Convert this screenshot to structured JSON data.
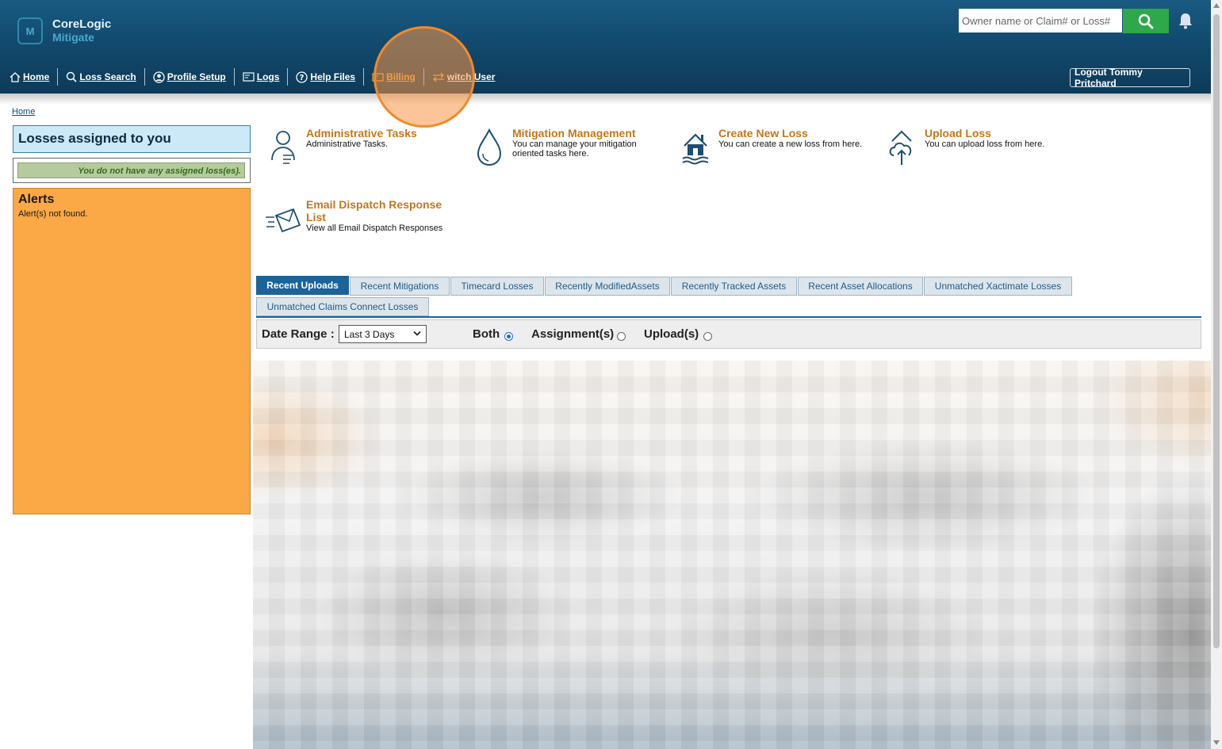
{
  "header": {
    "logo_line1": "CoreLogic",
    "logo_line2": "Mitigate",
    "logo_mark": "M",
    "search_placeholder": "Owner name or Claim# or Loss#",
    "logout_label": "Logout Tommy Pritchard"
  },
  "nav": {
    "items": [
      {
        "label": "Home",
        "icon": "home-icon"
      },
      {
        "label": "Loss Search",
        "icon": "search-icon"
      },
      {
        "label": "Profile Setup",
        "icon": "user-icon"
      },
      {
        "label": "Logs",
        "icon": "log-icon"
      },
      {
        "label": "Help Files",
        "icon": "help-icon"
      },
      {
        "label": "Billing",
        "icon": "billing-icon"
      },
      {
        "label": "witch User",
        "icon": "switch-icon"
      }
    ]
  },
  "breadcrumb": "Home",
  "sidebar": {
    "losses_title": "Losses assigned to you",
    "no_losses": "You do not have any assigned loss(es).",
    "alerts_title": "Alerts",
    "alerts_msg": "Alert(s) not found."
  },
  "tiles": [
    {
      "title": "Administrative Tasks",
      "desc": "Administrative Tasks."
    },
    {
      "title": "Mitigation Management",
      "desc": "You can manage your mitigation oriented tasks here."
    },
    {
      "title": "Create New Loss",
      "desc": "You can create a new loss from here."
    },
    {
      "title": "Upload Loss",
      "desc": "You can upload loss from here."
    },
    {
      "title": "Email Dispatch Response List",
      "desc": "View all Email Dispatch Responses"
    }
  ],
  "tabs": [
    "Recent Uploads",
    "Recent Mitigations",
    "Timecard Losses",
    "Recently ModifiedAssets",
    "Recently Tracked Assets",
    "Recent Asset Allocations",
    "Unmatched Xactimate Losses",
    "Unmatched Claims Connect Losses"
  ],
  "active_tab": "Recent Uploads",
  "filter": {
    "date_range_label": "Date Range :",
    "date_range_value": "Last 3 Days",
    "both_label": "Both",
    "assignments_label": "Assignment(s)",
    "uploads_label": "Upload(s)",
    "selected": "Both"
  },
  "colors": {
    "header": "#124a6e",
    "accent": "#c5761c",
    "alerts": "#fba846",
    "tab_active": "#1b6399",
    "search_button": "#2ea84a"
  }
}
